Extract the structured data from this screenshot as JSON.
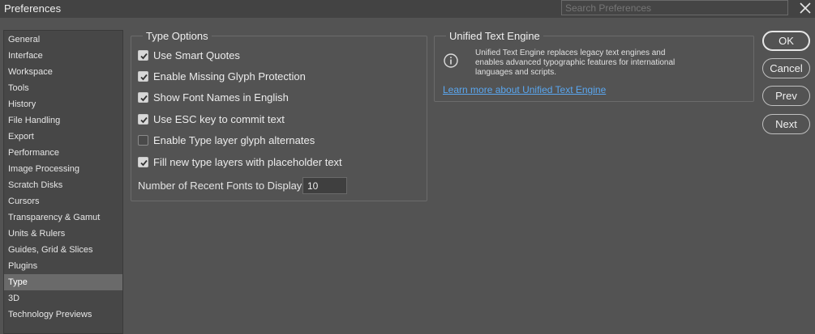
{
  "window": {
    "title": "Preferences"
  },
  "search": {
    "placeholder": "Search Preferences"
  },
  "sidebar": {
    "items": [
      {
        "label": "General"
      },
      {
        "label": "Interface"
      },
      {
        "label": "Workspace"
      },
      {
        "label": "Tools"
      },
      {
        "label": "History"
      },
      {
        "label": "File Handling"
      },
      {
        "label": "Export"
      },
      {
        "label": "Performance"
      },
      {
        "label": "Image Processing"
      },
      {
        "label": "Scratch Disks"
      },
      {
        "label": "Cursors"
      },
      {
        "label": "Transparency & Gamut"
      },
      {
        "label": "Units & Rulers"
      },
      {
        "label": "Guides, Grid & Slices"
      },
      {
        "label": "Plugins"
      },
      {
        "label": "Type"
      },
      {
        "label": "3D"
      },
      {
        "label": "Technology Previews"
      }
    ],
    "selected": "Type"
  },
  "type_options": {
    "title": "Type Options",
    "options": [
      {
        "label": "Use Smart Quotes",
        "checked": true
      },
      {
        "label": "Enable Missing Glyph Protection",
        "checked": true
      },
      {
        "label": "Show Font Names in English",
        "checked": true
      },
      {
        "label": "Use ESC key to commit text",
        "checked": true
      },
      {
        "label": "Enable Type layer glyph alternates",
        "checked": false
      },
      {
        "label": "Fill new type layers with placeholder text",
        "checked": true
      }
    ],
    "recent_fonts_label": "Number of Recent Fonts to Display:",
    "recent_fonts_value": "10"
  },
  "unified_text": {
    "title": "Unified Text Engine",
    "description": "Unified Text Engine replaces legacy text engines and enables advanced typographic features for international languages and scripts.",
    "link": "Learn more about Unified Text Engine"
  },
  "buttons": {
    "ok": "OK",
    "cancel": "Cancel",
    "prev": "Prev",
    "next": "Next"
  },
  "colors": {
    "background": "#535353",
    "panel": "#474747",
    "selected": "#6a6a6a",
    "link": "#5aa7f0"
  }
}
